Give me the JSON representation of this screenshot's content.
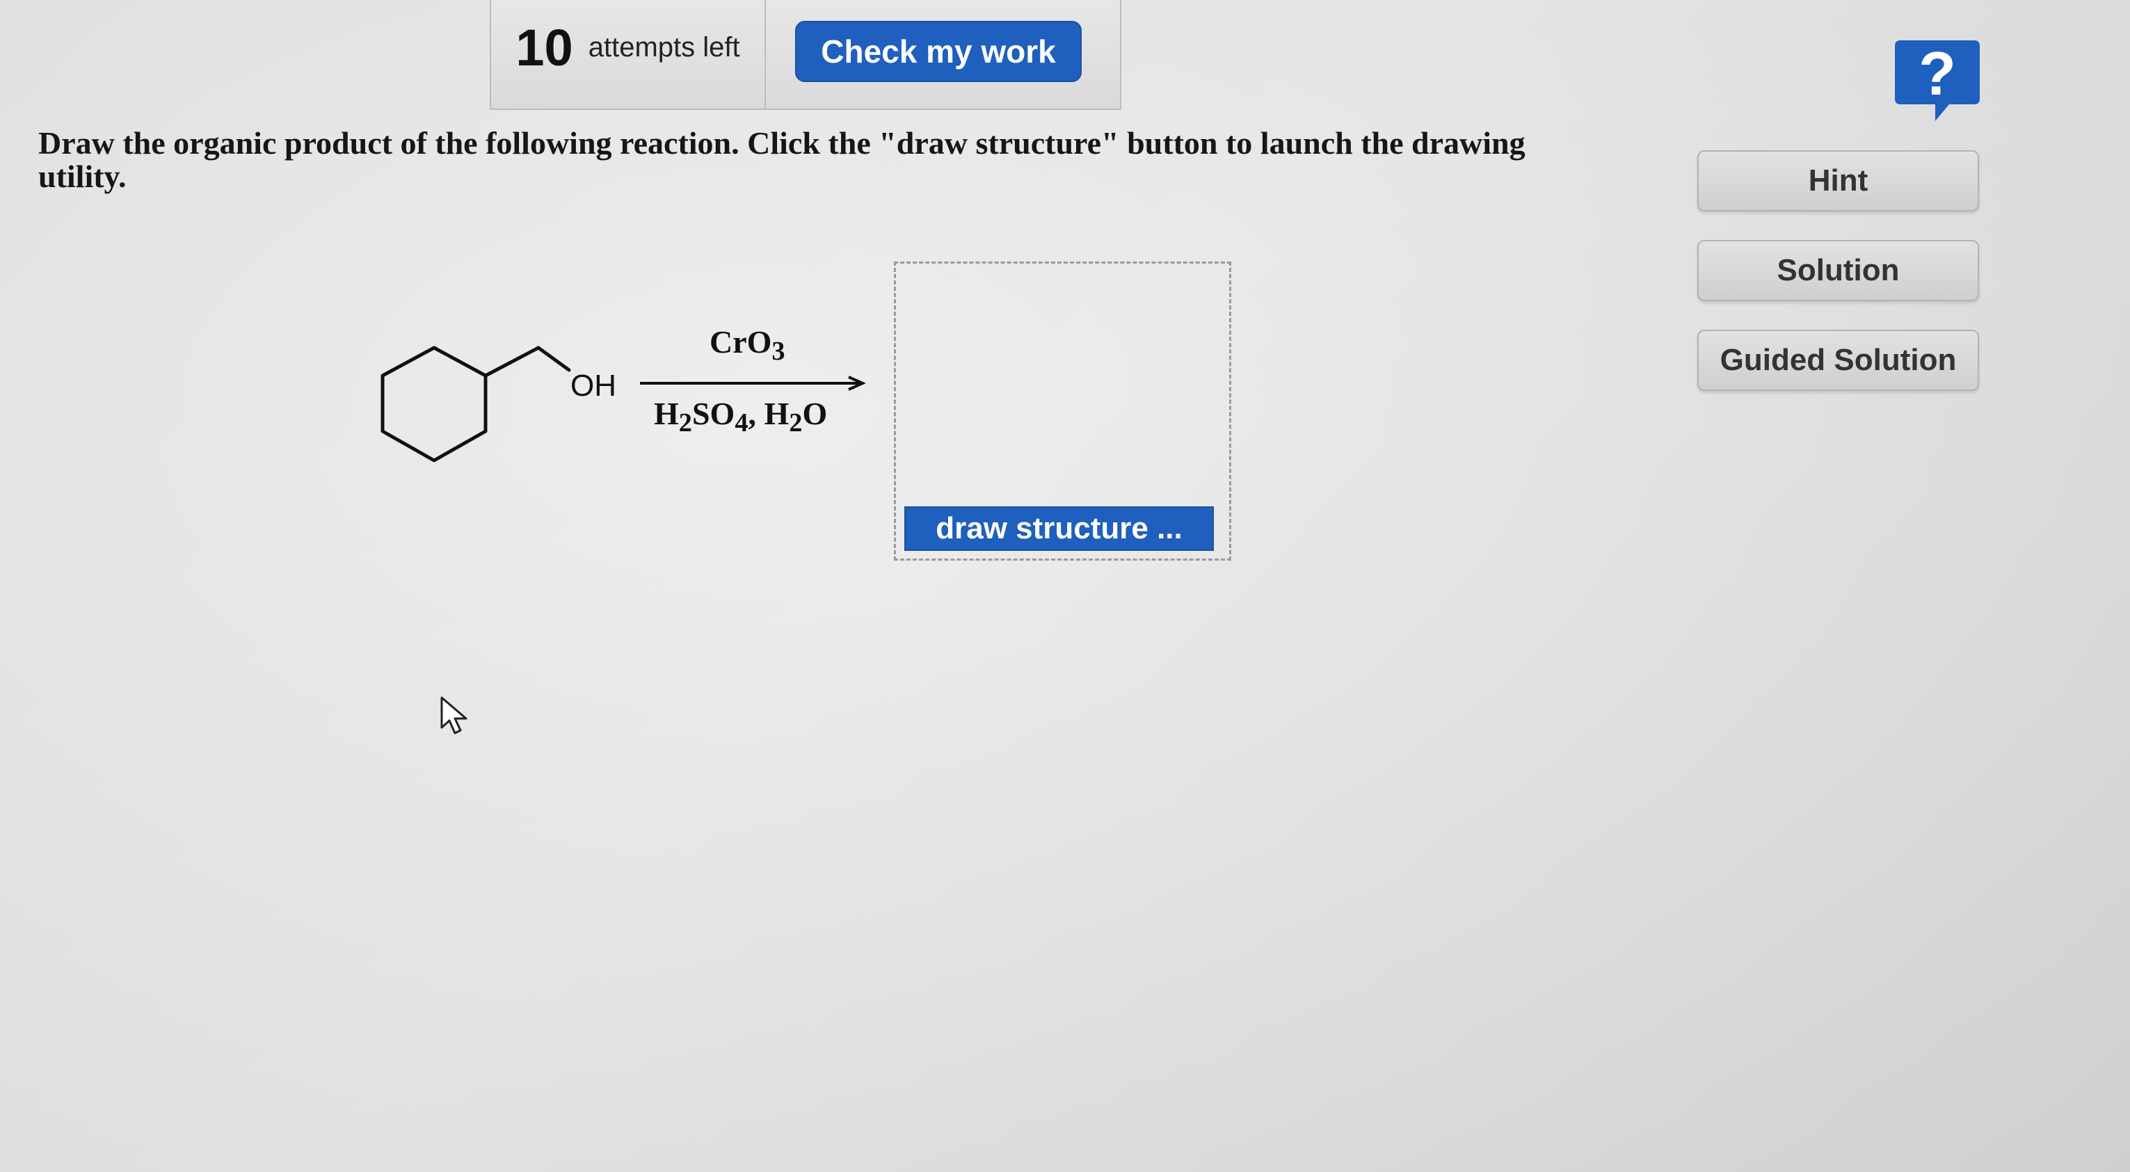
{
  "toolbar": {
    "attempts_count": "10",
    "attempts_label": "attempts left",
    "check_label": "Check my work"
  },
  "help": {
    "glyph": "?",
    "icon": "help-question-icon"
  },
  "question": {
    "text": "Draw the organic product of the following reaction. Click the \"draw structure\" button to launch the drawing utility."
  },
  "side_buttons": {
    "hint": "Hint",
    "solution": "Solution",
    "guided_solution": "Guided Solution"
  },
  "reaction": {
    "substituent_label": "OH",
    "reagent_top": {
      "main": "CrO",
      "sub": "3"
    },
    "reagent_bottom": {
      "a": "H",
      "a_sub": "2",
      "b": "SO",
      "b_sub": "4",
      "sep": ", ",
      "c": "H",
      "c_sub": "2",
      "d": "O"
    }
  },
  "drawing": {
    "button_label": "draw structure ..."
  },
  "colors": {
    "primary_button": "#1f5fbe",
    "help_icon": "#1f5fbe",
    "side_button_text": "#333333",
    "background": "#e6e6e8"
  },
  "icons": {
    "cursor": "mouse-pointer-icon",
    "arrow": "reaction-arrow-icon"
  }
}
